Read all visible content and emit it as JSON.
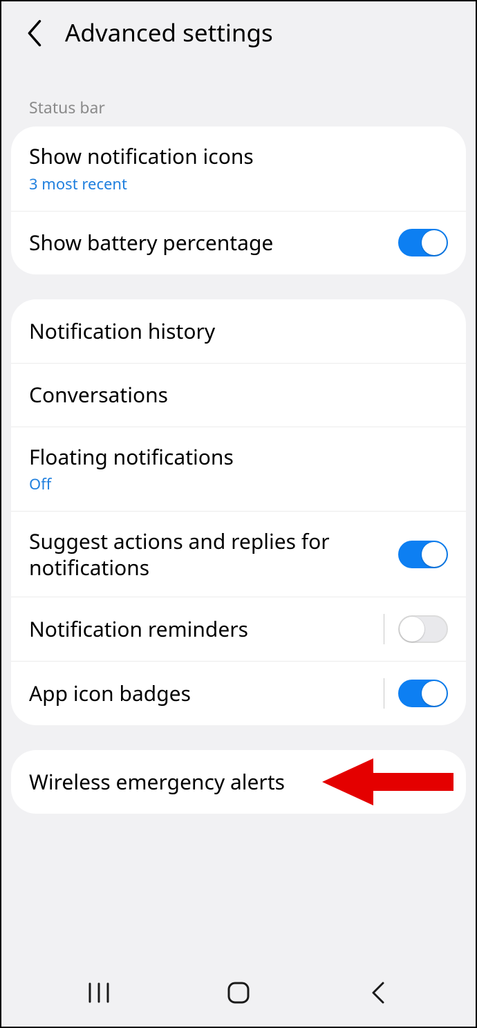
{
  "header": {
    "title": "Advanced settings"
  },
  "sections": {
    "statusBarHeader": "Status bar"
  },
  "rows": {
    "showNotificationIcons": {
      "title": "Show notification icons",
      "sub": "3 most recent"
    },
    "showBatteryPercentage": {
      "title": "Show battery percentage",
      "on": true
    },
    "notificationHistory": {
      "title": "Notification history"
    },
    "conversations": {
      "title": "Conversations"
    },
    "floatingNotifications": {
      "title": "Floating notifications",
      "sub": "Off"
    },
    "suggestActions": {
      "title": "Suggest actions and replies for notifications",
      "on": true
    },
    "notificationReminders": {
      "title": "Notification reminders",
      "on": false
    },
    "appIconBadges": {
      "title": "App icon badges",
      "on": true
    },
    "wirelessEmergency": {
      "title": "Wireless emergency alerts"
    }
  },
  "colors": {
    "accent": "#0d7ff2",
    "link": "#1f7fde",
    "arrow": "#e40000"
  }
}
